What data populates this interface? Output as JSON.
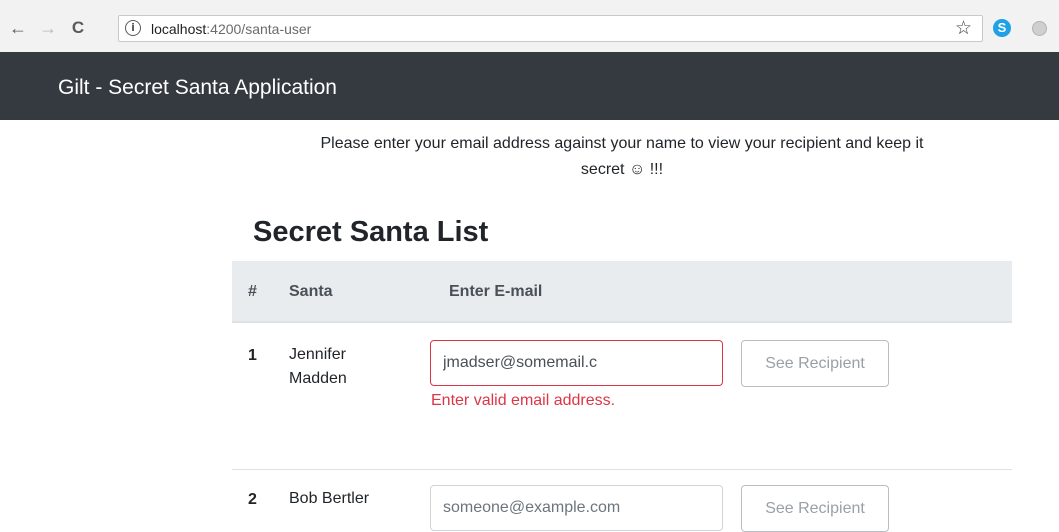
{
  "browser": {
    "url_host": "localhost",
    "url_path": ":4200/santa-user",
    "back_icon": "←",
    "forward_icon": "→",
    "reload_icon": "C",
    "info_icon": "i",
    "star_icon": "☆",
    "skype_icon": "S"
  },
  "navbar": {
    "brand": "Gilt - Secret Santa Application"
  },
  "main": {
    "intro_line1": "Please enter your email address against your name to view your recipient and keep it",
    "intro_line2": "secret ☺ !!!",
    "heading": "Secret Santa List",
    "table": {
      "headers": [
        "#",
        "Santa",
        "Enter E-mail"
      ],
      "rows": [
        {
          "num": "1",
          "name_line1": "Jennifer",
          "name_line2": "Madden",
          "email_value": "jmadser@somemail.c",
          "error": "Enter valid email address.",
          "button": "See Recipient"
        },
        {
          "num": "2",
          "name_line1": "Bob Bertler",
          "email_placeholder": "someone@example.com",
          "button": "See Recipient"
        }
      ]
    }
  },
  "colors": {
    "navbar_bg": "#343a40",
    "table_head_bg": "#e9ecef",
    "error": "#dc3545",
    "skype": "#1ea1e5"
  }
}
